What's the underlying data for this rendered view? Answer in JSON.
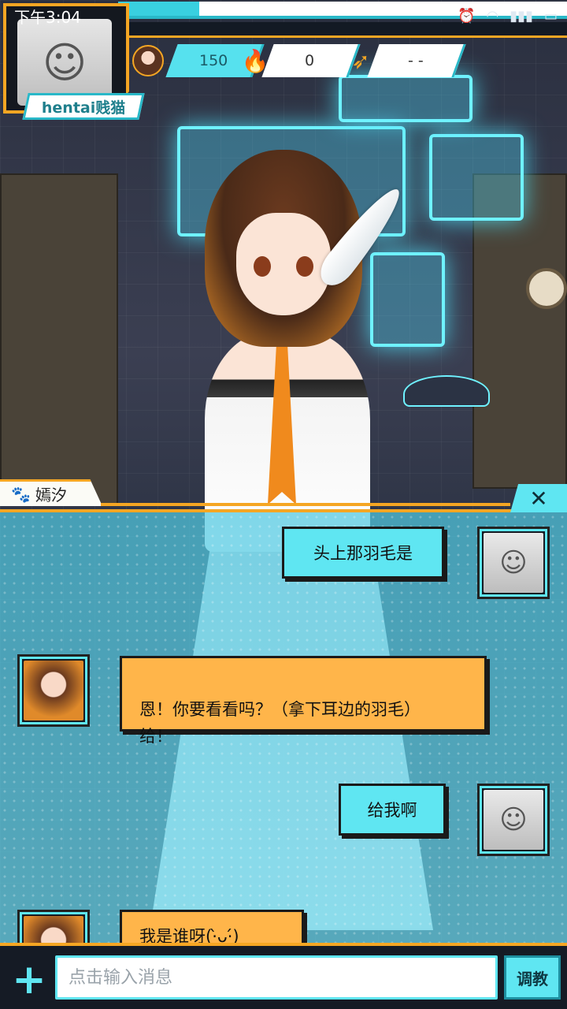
{
  "status_bar": {
    "time": "下午3:04",
    "icons": [
      "alarm-icon",
      "wifi-icon",
      "signal-icon",
      "battery-icon"
    ]
  },
  "player": {
    "name": "hentai贱猫"
  },
  "stats": {
    "affection": "150",
    "fire": "0",
    "wing": "- -"
  },
  "speaker": {
    "name": "嫣汐"
  },
  "close_label": "✕",
  "messages": [
    {
      "from": "user",
      "text": "头上那羽毛是"
    },
    {
      "from": "bot",
      "text": "恩！你要看看吗？（拿下耳边的羽毛）\n给！"
    },
    {
      "from": "user",
      "text": "给我啊"
    },
    {
      "from": "bot",
      "text": "我是谁呀(·̀ᴗ·́)"
    }
  ],
  "input": {
    "placeholder": "点击输入消息",
    "send_label": "调教"
  },
  "colors": {
    "accent_orange": "#f5a623",
    "accent_cyan": "#5fe6f2",
    "bot_bubble": "#ffb54a"
  }
}
